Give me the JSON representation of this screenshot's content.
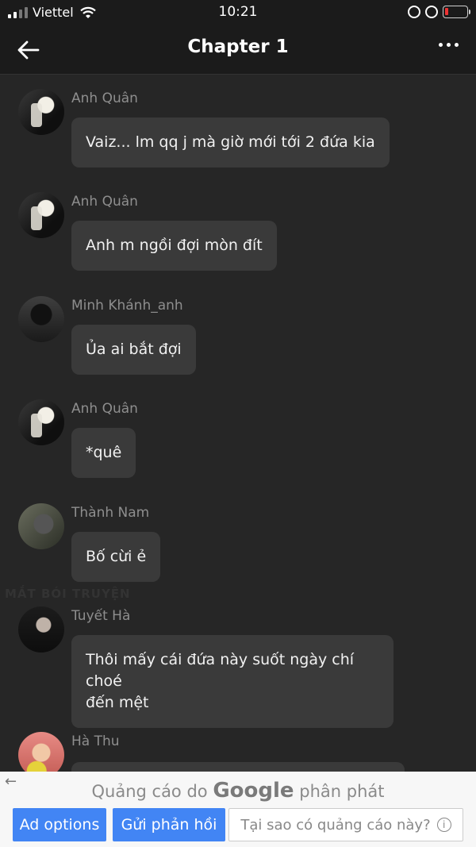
{
  "status_bar": {
    "carrier": "Viettel",
    "time": "10:21"
  },
  "header": {
    "title": "Chapter 1"
  },
  "messages": [
    {
      "name": "Anh Quân",
      "text": "Vaiz... lm qq j mà giờ mới tới 2 đứa kia"
    },
    {
      "name": "Anh Quân",
      "text": "Anh m ngồi đợi mòn đít"
    },
    {
      "name": "Minh Khánh_anh",
      "text": "Ủa ai bắt đợi"
    },
    {
      "name": "Anh Quân",
      "text": "*quê"
    },
    {
      "name": "Thành Nam",
      "text": "Bố cừi ẻ"
    },
    {
      "name": "Tuyết Hà",
      "text": "Thôi mấy cái đứa này suốt ngày chí choé",
      "text2": "đến mệt"
    },
    {
      "name": "Hà Thu",
      "text": ""
    }
  ],
  "ad": {
    "caption_pre": "Quảng cáo do",
    "caption_brand": "Google",
    "caption_post": "phân phát",
    "ad_options": "Ad options",
    "feedback": "Gửi phản hồi",
    "why": "Tại sao có quảng cáo này?"
  }
}
